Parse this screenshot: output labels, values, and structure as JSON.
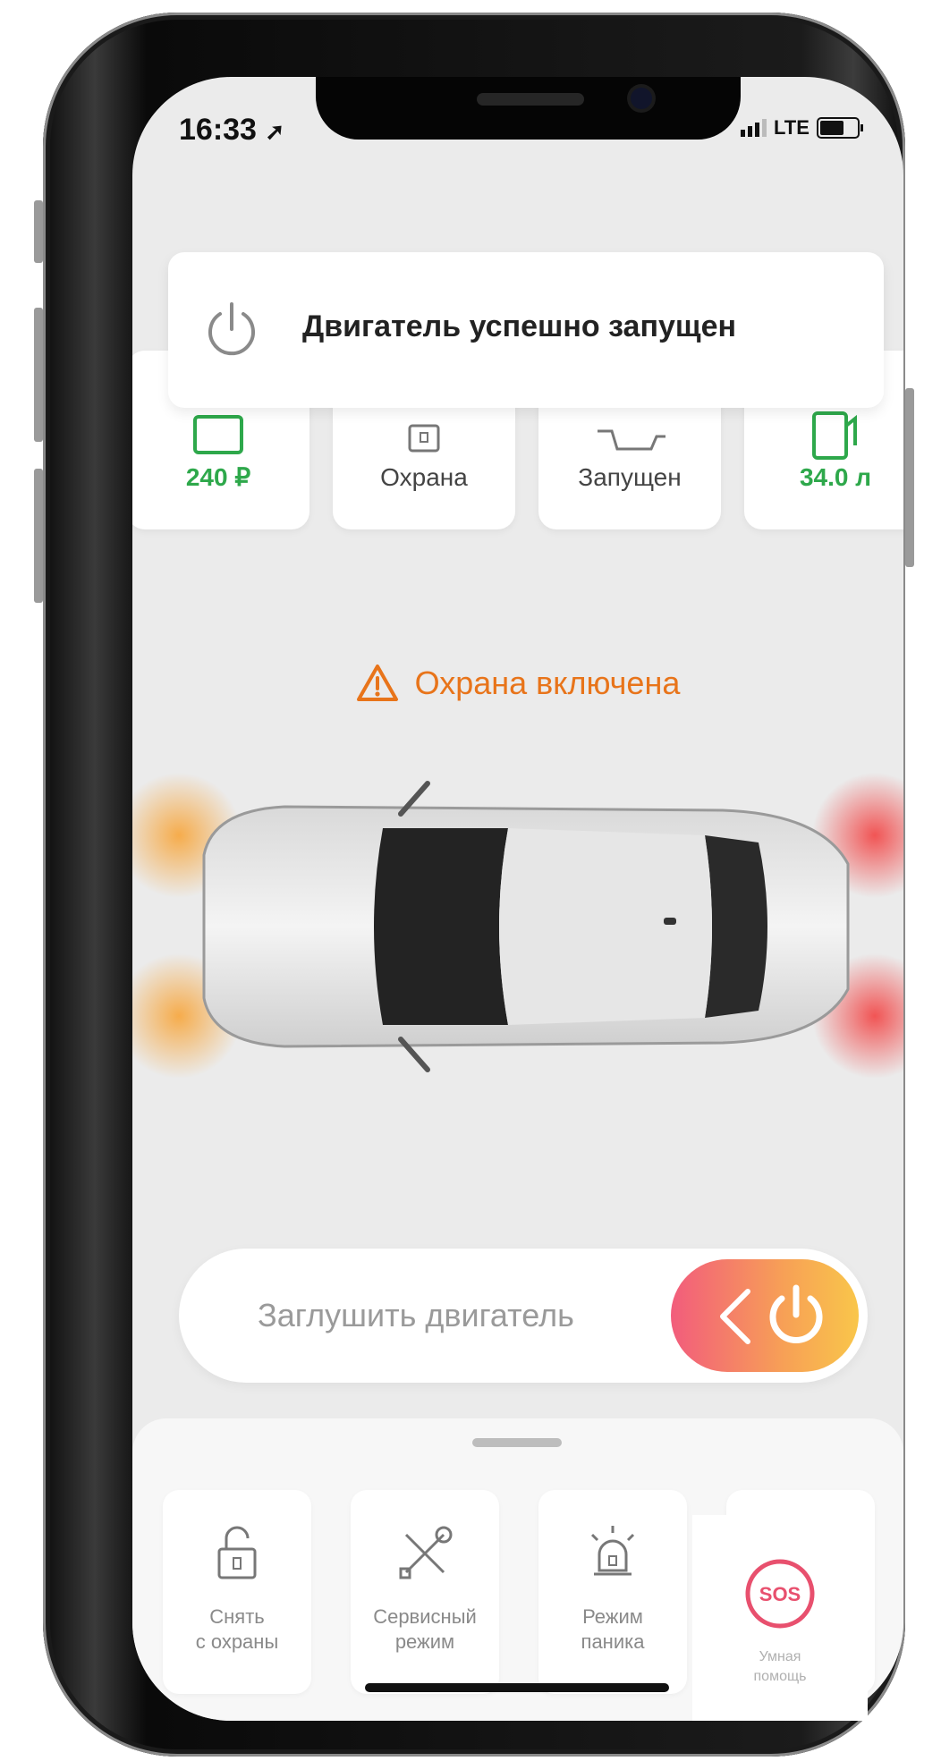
{
  "status_bar": {
    "time": "16:33",
    "network": "LTE"
  },
  "toast": {
    "message": "Двигатель успешно запущен",
    "icon": "power-icon"
  },
  "tiles": [
    {
      "value": "240 ₽",
      "icon": "wallet-icon",
      "accent": "#2ea84b"
    },
    {
      "value": "Охрана",
      "icon": "lock-icon",
      "accent": "#444444"
    },
    {
      "value": "Запущен",
      "icon": "engine-icon",
      "accent": "#444444"
    },
    {
      "value": "34.0 л",
      "icon": "fuel-icon",
      "accent": "#2ea84b"
    }
  ],
  "alarm": {
    "text": "Охрана включена",
    "icon": "warning-icon",
    "color": "#e8741a"
  },
  "engine_control": {
    "label": "Заглушить двигатель",
    "icon": "power-icon",
    "gradient": [
      "#f25c7c",
      "#f9c64a"
    ]
  },
  "actions": [
    {
      "label": "Снять\nс охраны",
      "icon": "unlock-icon"
    },
    {
      "label": "Сервисный\nрежим",
      "icon": "tools-icon"
    },
    {
      "label": "Режим\nпаника",
      "icon": "siren-icon"
    },
    {
      "label": "Умная\nпомощь",
      "icon": "sos-icon"
    }
  ]
}
